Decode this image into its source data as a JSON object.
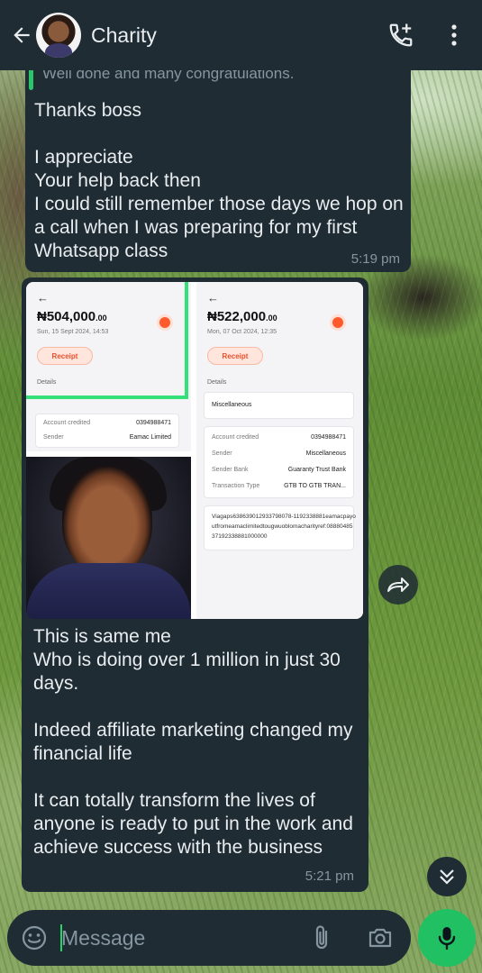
{
  "header": {
    "contact_name": "Charity",
    "icons": {
      "back": "arrow-left-icon",
      "call_add": "call-add-icon",
      "menu": "more-vertical-icon"
    }
  },
  "messages": [
    {
      "quoted_text": "Well done and many congratulations.",
      "text": "Thanks boss\n\nI appreciate\nYour help back then\nI could still remember those days we hop on a call when I was preparing for my first Whatsapp class",
      "time": "5:19 pm"
    },
    {
      "text": "This is same me\nWho is doing over 1 million in just 30 days.\n\nIndeed affiliate marketing changed my financial life\n\nIt can totally transform the lives of anyone is ready to put in the work and achieve success with the business",
      "time": "5:21 pm",
      "images": {
        "receipt_1": {
          "amount": "₦504,000",
          "amount_decimal": ".00",
          "date": "Sun, 15 Sept 2024, 14:53",
          "receipt_label": "Receipt",
          "details_label": "Details",
          "rows": [
            {
              "label": "Account credited",
              "value": "0394988471"
            },
            {
              "label": "Sender",
              "value": "Eamac Limited"
            }
          ]
        },
        "receipt_2": {
          "amount": "₦522,000",
          "amount_decimal": ".00",
          "date": "Mon, 07 Oct 2024, 12:35",
          "receipt_label": "Receipt",
          "details_label": "Details",
          "category": "Miscellaneous",
          "rows": [
            {
              "label": "Account credited",
              "value": "0394988471"
            },
            {
              "label": "Sender",
              "value": "Miscellaneous"
            },
            {
              "label": "Sender Bank",
              "value": "Guaranty Trust Bank"
            },
            {
              "label": "Transaction Type",
              "value": "GTB TO GTB TRAN..."
            }
          ],
          "reference": "Viagaps638639012933798078-1192338881eamacpayoutfromeamaclimitedtougwuoblomacharityref:0888048537192338881000000"
        }
      }
    }
  ],
  "input": {
    "placeholder": "Message",
    "icons": {
      "emoji": "emoji-icon",
      "attach": "paperclip-icon",
      "camera": "camera-icon",
      "mic": "mic-icon"
    }
  },
  "floating": {
    "forward": "forward-icon",
    "scroll_down": "double-chevron-down-icon"
  },
  "colors": {
    "header": "#1f2c34",
    "bubble": "#1f2c34",
    "accent": "#21c063",
    "meta_text": "#8696a0"
  }
}
